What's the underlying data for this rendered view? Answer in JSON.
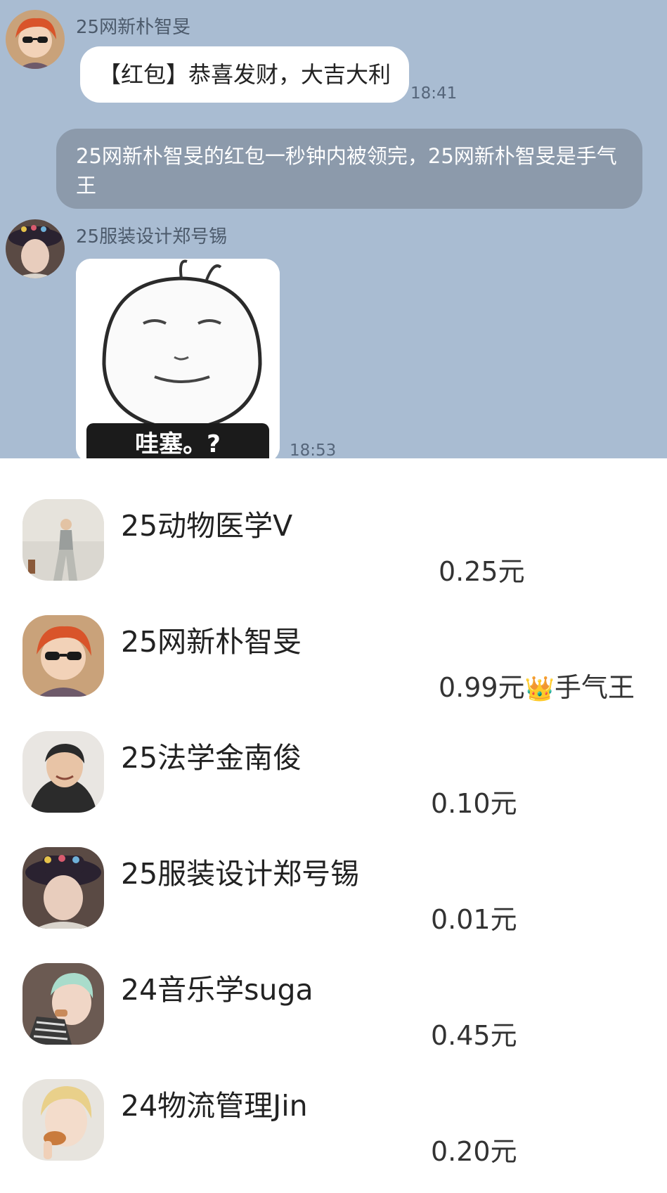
{
  "chat": {
    "messages": [
      {
        "sender": "25网新朴智旻",
        "text": "【红包】恭喜发财，大吉大利",
        "time": "18:41"
      },
      {
        "system": "25网新朴智旻的红包一秒钟内被领完，25网新朴智旻是手气王"
      },
      {
        "sender": "25服装设计郑号锡",
        "sticker_caption": "哇塞。?",
        "time": "18:53"
      }
    ]
  },
  "receivers": [
    {
      "name": "25动物医学V",
      "amount": "0.25元",
      "badge": ""
    },
    {
      "name": "25网新朴智旻",
      "amount": "0.99元",
      "badge": "👑",
      "badge_text": "手气王"
    },
    {
      "name": "25法学金南俊",
      "amount": "0.10元",
      "badge": ""
    },
    {
      "name": "25服装设计郑号锡",
      "amount": "0.01元",
      "badge": ""
    },
    {
      "name": "24音乐学suga",
      "amount": "0.45元",
      "badge": ""
    },
    {
      "name": "24物流管理Jin",
      "amount": "0.20元",
      "badge": ""
    }
  ],
  "colors": {
    "chat_background": "#a9bcd2",
    "system_bubble": "#8c9aab",
    "list_background": "#ffffff"
  }
}
